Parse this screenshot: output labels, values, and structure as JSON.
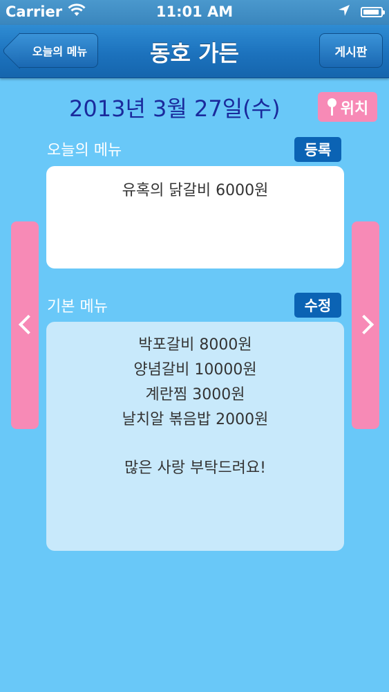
{
  "status_bar": {
    "carrier": "Carrier",
    "time": "11:01 AM",
    "battery_level": 0.9
  },
  "nav": {
    "title": "동호 가든",
    "back_label": "오늘의 메뉴",
    "right_label": "게시판"
  },
  "date": "2013년 3월 27일(수)",
  "location_button": "위치",
  "today_menu": {
    "label": "오늘의 메뉴",
    "button": "등록",
    "items": [
      "유혹의 닭갈비 6000원"
    ]
  },
  "basic_menu": {
    "label": "기본 메뉴",
    "button": "수정",
    "items": [
      "박포갈비 8000원",
      "양념갈비 10000원",
      "계란찜 3000원",
      "날치알 볶음밥 2000원"
    ],
    "note": "많은 사랑 부탁드려요!"
  },
  "colors": {
    "background": "#69c8f8",
    "nav": "#1c72bd",
    "pink": "#f78ab6",
    "date_text": "#1a2a9c",
    "tag": "#0b63b4"
  }
}
